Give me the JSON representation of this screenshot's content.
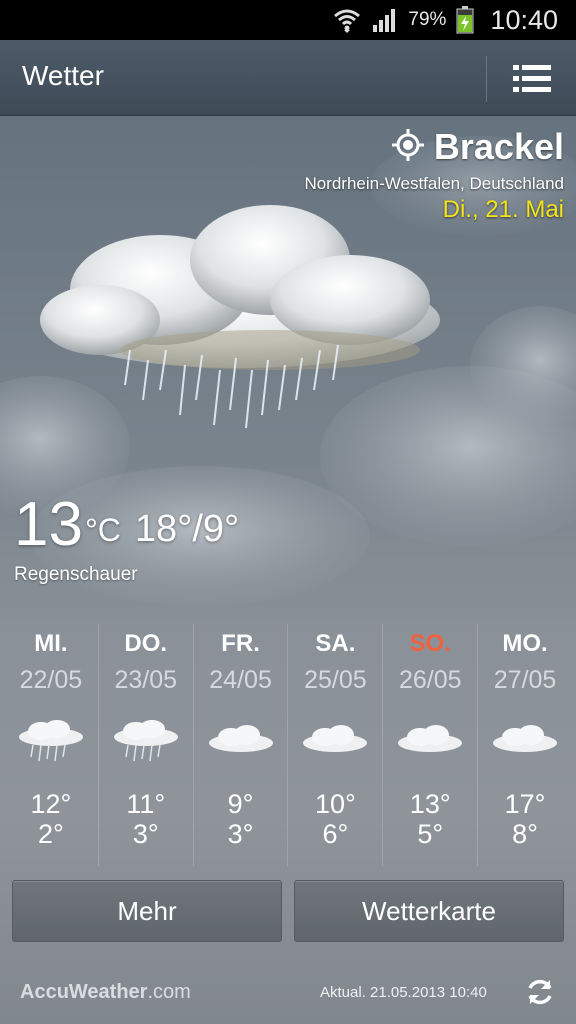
{
  "status_bar": {
    "icons": [
      "wifi-icon",
      "signal-icon",
      "battery-charging-icon"
    ],
    "battery_percent": "79%",
    "time": "10:40"
  },
  "action_bar": {
    "title": "Wetter",
    "menu_icon": "list-menu-icon"
  },
  "location": {
    "icon": "gps-location-icon",
    "city": "Brackel",
    "region": "Nordrhein-Westfalen, Deutschland",
    "date": "Di., 21. Mai"
  },
  "current": {
    "icon": "cloud-rain-icon",
    "temp": "13",
    "unit": "°C",
    "hilo": "18°/9°",
    "condition": "Regenschauer"
  },
  "forecast": [
    {
      "day": "MI.",
      "date": "22/05",
      "icon": "rain-cloud-icon",
      "high": "12°",
      "low": "2°"
    },
    {
      "day": "DO.",
      "date": "23/05",
      "icon": "rain-cloud-icon",
      "high": "11°",
      "low": "3°"
    },
    {
      "day": "FR.",
      "date": "24/05",
      "icon": "cloud-icon",
      "high": "9°",
      "low": "3°"
    },
    {
      "day": "SA.",
      "date": "25/05",
      "icon": "cloud-icon",
      "high": "10°",
      "low": "6°"
    },
    {
      "day": "SO.",
      "date": "26/05",
      "icon": "cloud-icon",
      "high": "13°",
      "low": "5°"
    },
    {
      "day": "MO.",
      "date": "27/05",
      "icon": "cloud-icon",
      "high": "17°",
      "low": "8°"
    }
  ],
  "buttons": {
    "more": "Mehr",
    "map": "Wetterkarte"
  },
  "footer": {
    "brand_main": "AccuWeather",
    "brand_suffix": ".com",
    "updated": "Aktual. 21.05.2013 10:40",
    "refresh_icon": "refresh-icon"
  },
  "colors": {
    "date_accent": "#f4e418",
    "sunday_accent": "#f0623e"
  }
}
